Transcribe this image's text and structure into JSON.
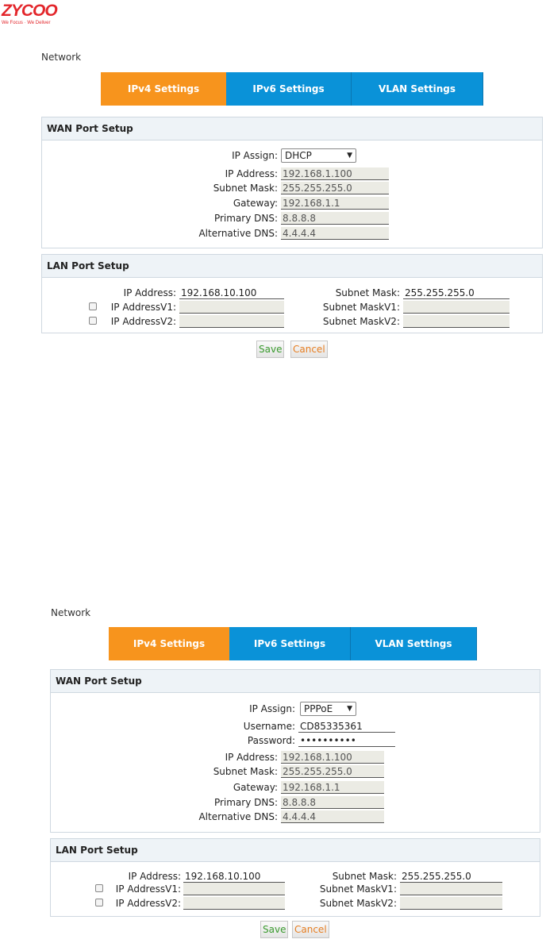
{
  "logo": {
    "text": "ZYCOO",
    "tagline": "We Focus · We Deliver"
  },
  "colors": {
    "tab_active": "#f7941d",
    "tab_inactive": "#0a92d8",
    "save": "#3a9a2e",
    "cancel": "#e67e22",
    "brand": "#e3262b"
  },
  "shots": [
    {
      "section": "Network",
      "tabs": [
        {
          "label": "IPv4 Settings",
          "active": true
        },
        {
          "label": "IPv6 Settings",
          "active": false
        },
        {
          "label": "VLAN Settings",
          "active": false
        }
      ],
      "wan": {
        "title": "WAN Port Setup",
        "ip_assign_label": "IP Assign:",
        "ip_assign_value": "DHCP",
        "fields": [
          {
            "label": "IP Address:",
            "value": "192.168.1.100"
          },
          {
            "label": "Subnet Mask:",
            "value": "255.255.255.0"
          },
          {
            "label": "Gateway:",
            "value": "192.168.1.1"
          },
          {
            "label": "Primary DNS:",
            "value": "8.8.8.8"
          },
          {
            "label": "Alternative DNS:",
            "value": "4.4.4.4"
          }
        ]
      },
      "lan": {
        "title": "LAN Port Setup",
        "ip_label": "IP Address:",
        "ip_value": "192.168.10.100",
        "mask_label": "Subnet Mask:",
        "mask_value": "255.255.255.0",
        "ipv1_label": "IP AddressV1:",
        "ipv1_value": "",
        "maskv1_label": "Subnet MaskV1:",
        "maskv1_value": "",
        "ipv2_label": "IP AddressV2:",
        "ipv2_value": "",
        "maskv2_label": "Subnet MaskV2:",
        "maskv2_value": ""
      },
      "save": "Save",
      "cancel": "Cancel"
    },
    {
      "section": "Network",
      "tabs": [
        {
          "label": "IPv4 Settings",
          "active": true
        },
        {
          "label": "IPv6 Settings",
          "active": false
        },
        {
          "label": "VLAN Settings",
          "active": false
        }
      ],
      "wan": {
        "title": "WAN Port Setup",
        "ip_assign_label": "IP Assign:",
        "ip_assign_value": "PPPoE",
        "username_label": "Username:",
        "username_value": "CD85335361",
        "password_label": "Password:",
        "password_value": "••••••••••",
        "fields": [
          {
            "label": "IP Address:",
            "value": "192.168.1.100"
          },
          {
            "label": "Subnet Mask:",
            "value": "255.255.255.0"
          },
          {
            "label": "Gateway:",
            "value": "192.168.1.1"
          },
          {
            "label": "Primary DNS:",
            "value": "8.8.8.8"
          },
          {
            "label": "Alternative DNS:",
            "value": "4.4.4.4"
          }
        ]
      },
      "lan": {
        "title": "LAN Port Setup",
        "ip_label": "IP Address:",
        "ip_value": "192.168.10.100",
        "mask_label": "Subnet Mask:",
        "mask_value": "255.255.255.0",
        "ipv1_label": "IP AddressV1:",
        "ipv1_value": "",
        "maskv1_label": "Subnet MaskV1:",
        "maskv1_value": "",
        "ipv2_label": "IP AddressV2:",
        "ipv2_value": "",
        "maskv2_label": "Subnet MaskV2:",
        "maskv2_value": ""
      },
      "save": "Save",
      "cancel": "Cancel"
    }
  ]
}
